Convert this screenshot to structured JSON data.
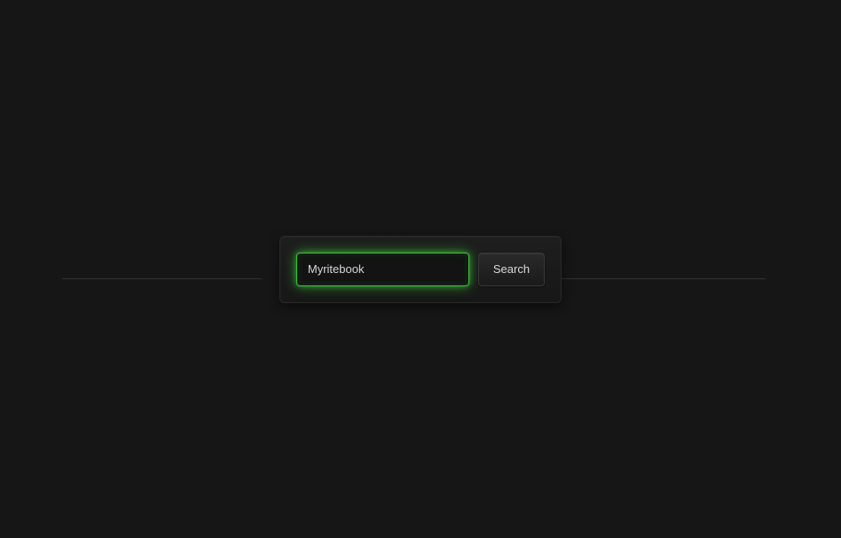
{
  "search": {
    "input_value": "Myritebook",
    "placeholder": "",
    "button_label": "Search"
  },
  "colors": {
    "background": "#161616",
    "glow": "#3fc23f",
    "text": "#d8d8d8"
  }
}
